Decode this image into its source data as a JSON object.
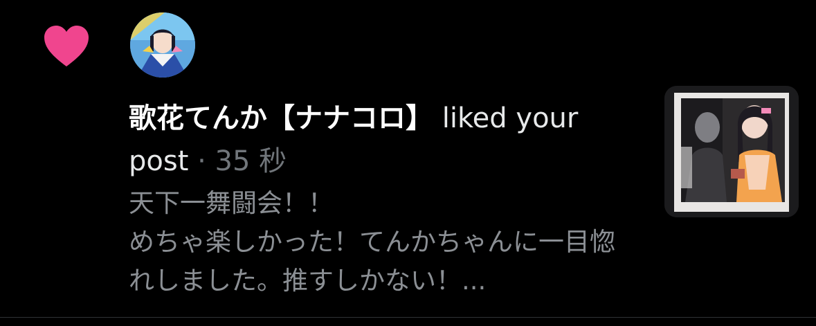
{
  "notification": {
    "type_icon": "heart-icon",
    "icon_color": "#f0458e",
    "avatar": {
      "icon": "user-avatar-image"
    },
    "user_name": "歌花てんか【ナナコロ】",
    "action_text": " liked your post",
    "separator": " · ",
    "timestamp": "35 秒",
    "post_text": "天下一舞闘会！！\nめちゃ楽しかった！てんかちゃんに一目惚れしました。推すしかない！...",
    "thumbnail": {
      "icon": "post-photo-thumbnail"
    }
  },
  "colors": {
    "background": "#000000",
    "primary_text": "#e7e9ea",
    "secondary_text": "#71767b",
    "like_pink": "#f0458e"
  }
}
